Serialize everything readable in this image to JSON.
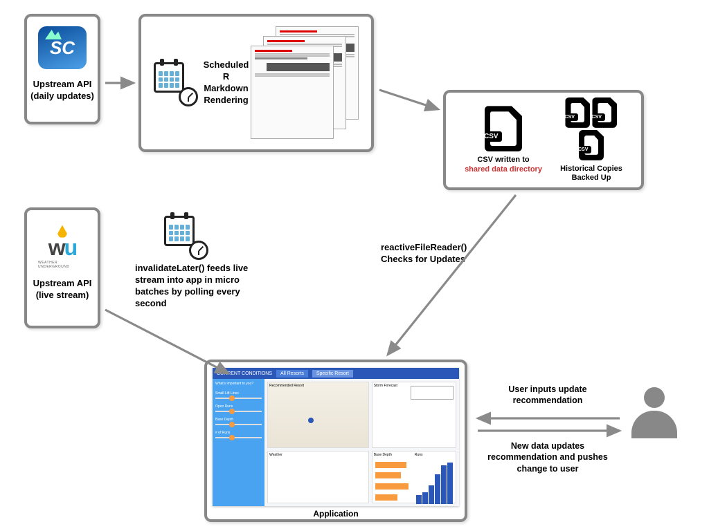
{
  "nodes": {
    "api_daily": {
      "label": "Upstream API\n(daily updates)",
      "logo_text": "SC"
    },
    "markdown": {
      "label": "Scheduled R\nMarkdown\nRendering"
    },
    "csv": {
      "written_label": "CSV written to",
      "written_highlight": "shared data directory",
      "backup_label": "Historical Copies\nBacked Up"
    },
    "api_live": {
      "label": "Upstream API\n(live stream)",
      "logo_main_w": "w",
      "logo_main_u": "u",
      "logo_sub": "WEATHER UNDERGROUND"
    },
    "application": {
      "label": "Application"
    }
  },
  "arrows": {
    "invalidate": "invalidateLater() feeds live stream into app in micro batches by polling every second",
    "reactive": "reactiveFileReader()\nChecks for Updates",
    "user_in": "User inputs update recommendation",
    "user_out": "New  data updates recommendation and pushes change to user"
  },
  "app_ui": {
    "title": "CURRENT CONDITIONS",
    "tab1": "All Resorts",
    "tab2": "Specific Resort",
    "side_q": "What's important to you?",
    "side1": "Small Lift Lines",
    "side2": "Open Runs",
    "side3": "Base Depth",
    "side4": "# of Runs",
    "panel_map": "Recommended Resort",
    "panel_forecast": "Storm Forecast",
    "panel_weather": "Weather",
    "panel_base": "Base Depth",
    "panel_runs": "Runs"
  }
}
